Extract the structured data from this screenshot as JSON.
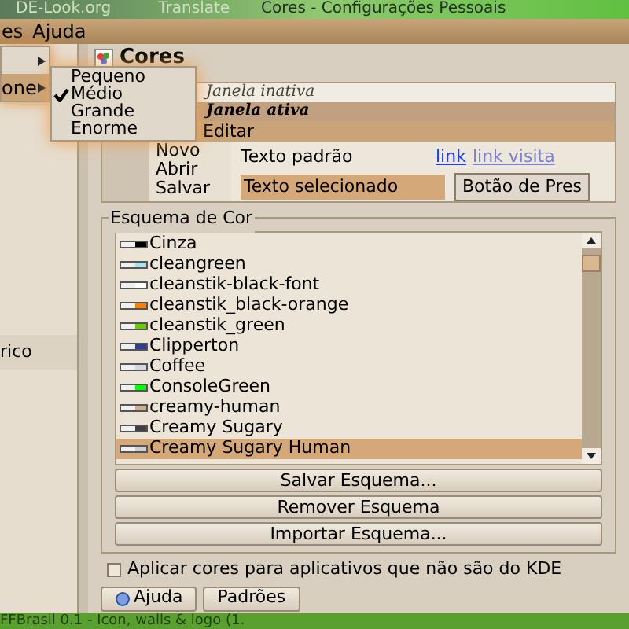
{
  "background": {
    "texts": [
      "DE-Look.org",
      "Translate"
    ],
    "taskbar": "FFBrasil 0.1 - Icon, walls & logo (1."
  },
  "window": {
    "title": "Cores - Configurações Pessoais"
  },
  "menubar": [
    "es",
    "Ajuda"
  ],
  "popup_menu": {
    "items": [
      {
        "has_submenu": true
      },
      {
        "label": "one",
        "has_submenu": true
      }
    ]
  },
  "submenu": {
    "items": [
      {
        "label": "Pequeno",
        "checked": false
      },
      {
        "label": "Médio",
        "checked": true
      },
      {
        "label": "Grande",
        "checked": false
      },
      {
        "label": "Enorme",
        "checked": false
      }
    ]
  },
  "sidebar": {
    "items": [
      {
        "label": "rico"
      }
    ]
  },
  "header": {
    "title": "Cores"
  },
  "preview": {
    "inactive_title": "Janela inativa",
    "active_title": "Janela ativa",
    "menubar": [
      "Editar"
    ],
    "menu_items": [
      "Novo",
      "Abrir",
      "Salvar"
    ],
    "standard_text": "Texto padrão",
    "selected_text": "Texto selecionado",
    "link": "link",
    "visited_link": "link visita",
    "button": "Botão de Pres"
  },
  "scheme_group": {
    "title": "Esquema de Cor",
    "schemes": [
      {
        "label": "Cinza",
        "color": "#000000",
        "selected": false
      },
      {
        "label": "cleangreen",
        "color": "#aee0f0",
        "selected": false
      },
      {
        "label": "cleanstik-black-font",
        "color": "#ffffff",
        "selected": false
      },
      {
        "label": "cleanstik_black-orange",
        "color": "#ff8000",
        "selected": false
      },
      {
        "label": "cleanstik_green",
        "color": "#66cc00",
        "selected": false
      },
      {
        "label": "Clipperton",
        "color": "#2f3f8f",
        "selected": false
      },
      {
        "label": "Coffee",
        "color": "#d0d8e0",
        "selected": false
      },
      {
        "label": "ConsoleGreen",
        "color": "#00ff00",
        "selected": false
      },
      {
        "label": "creamy-human",
        "color": "#c8b090",
        "selected": false
      },
      {
        "label": "Creamy Sugary",
        "color": "#404040",
        "selected": false
      },
      {
        "label": "Creamy Sugary Human",
        "color": "#d0d0d0",
        "selected": true
      }
    ],
    "buttons": [
      "Salvar Esquema...",
      "Remover Esquema",
      "Importar Esquema..."
    ]
  },
  "apply_checkbox": {
    "label": "Aplicar cores para aplicativos que não são do KDE",
    "checked": false
  },
  "footer_buttons": [
    "Ajuda",
    "Padrões"
  ]
}
